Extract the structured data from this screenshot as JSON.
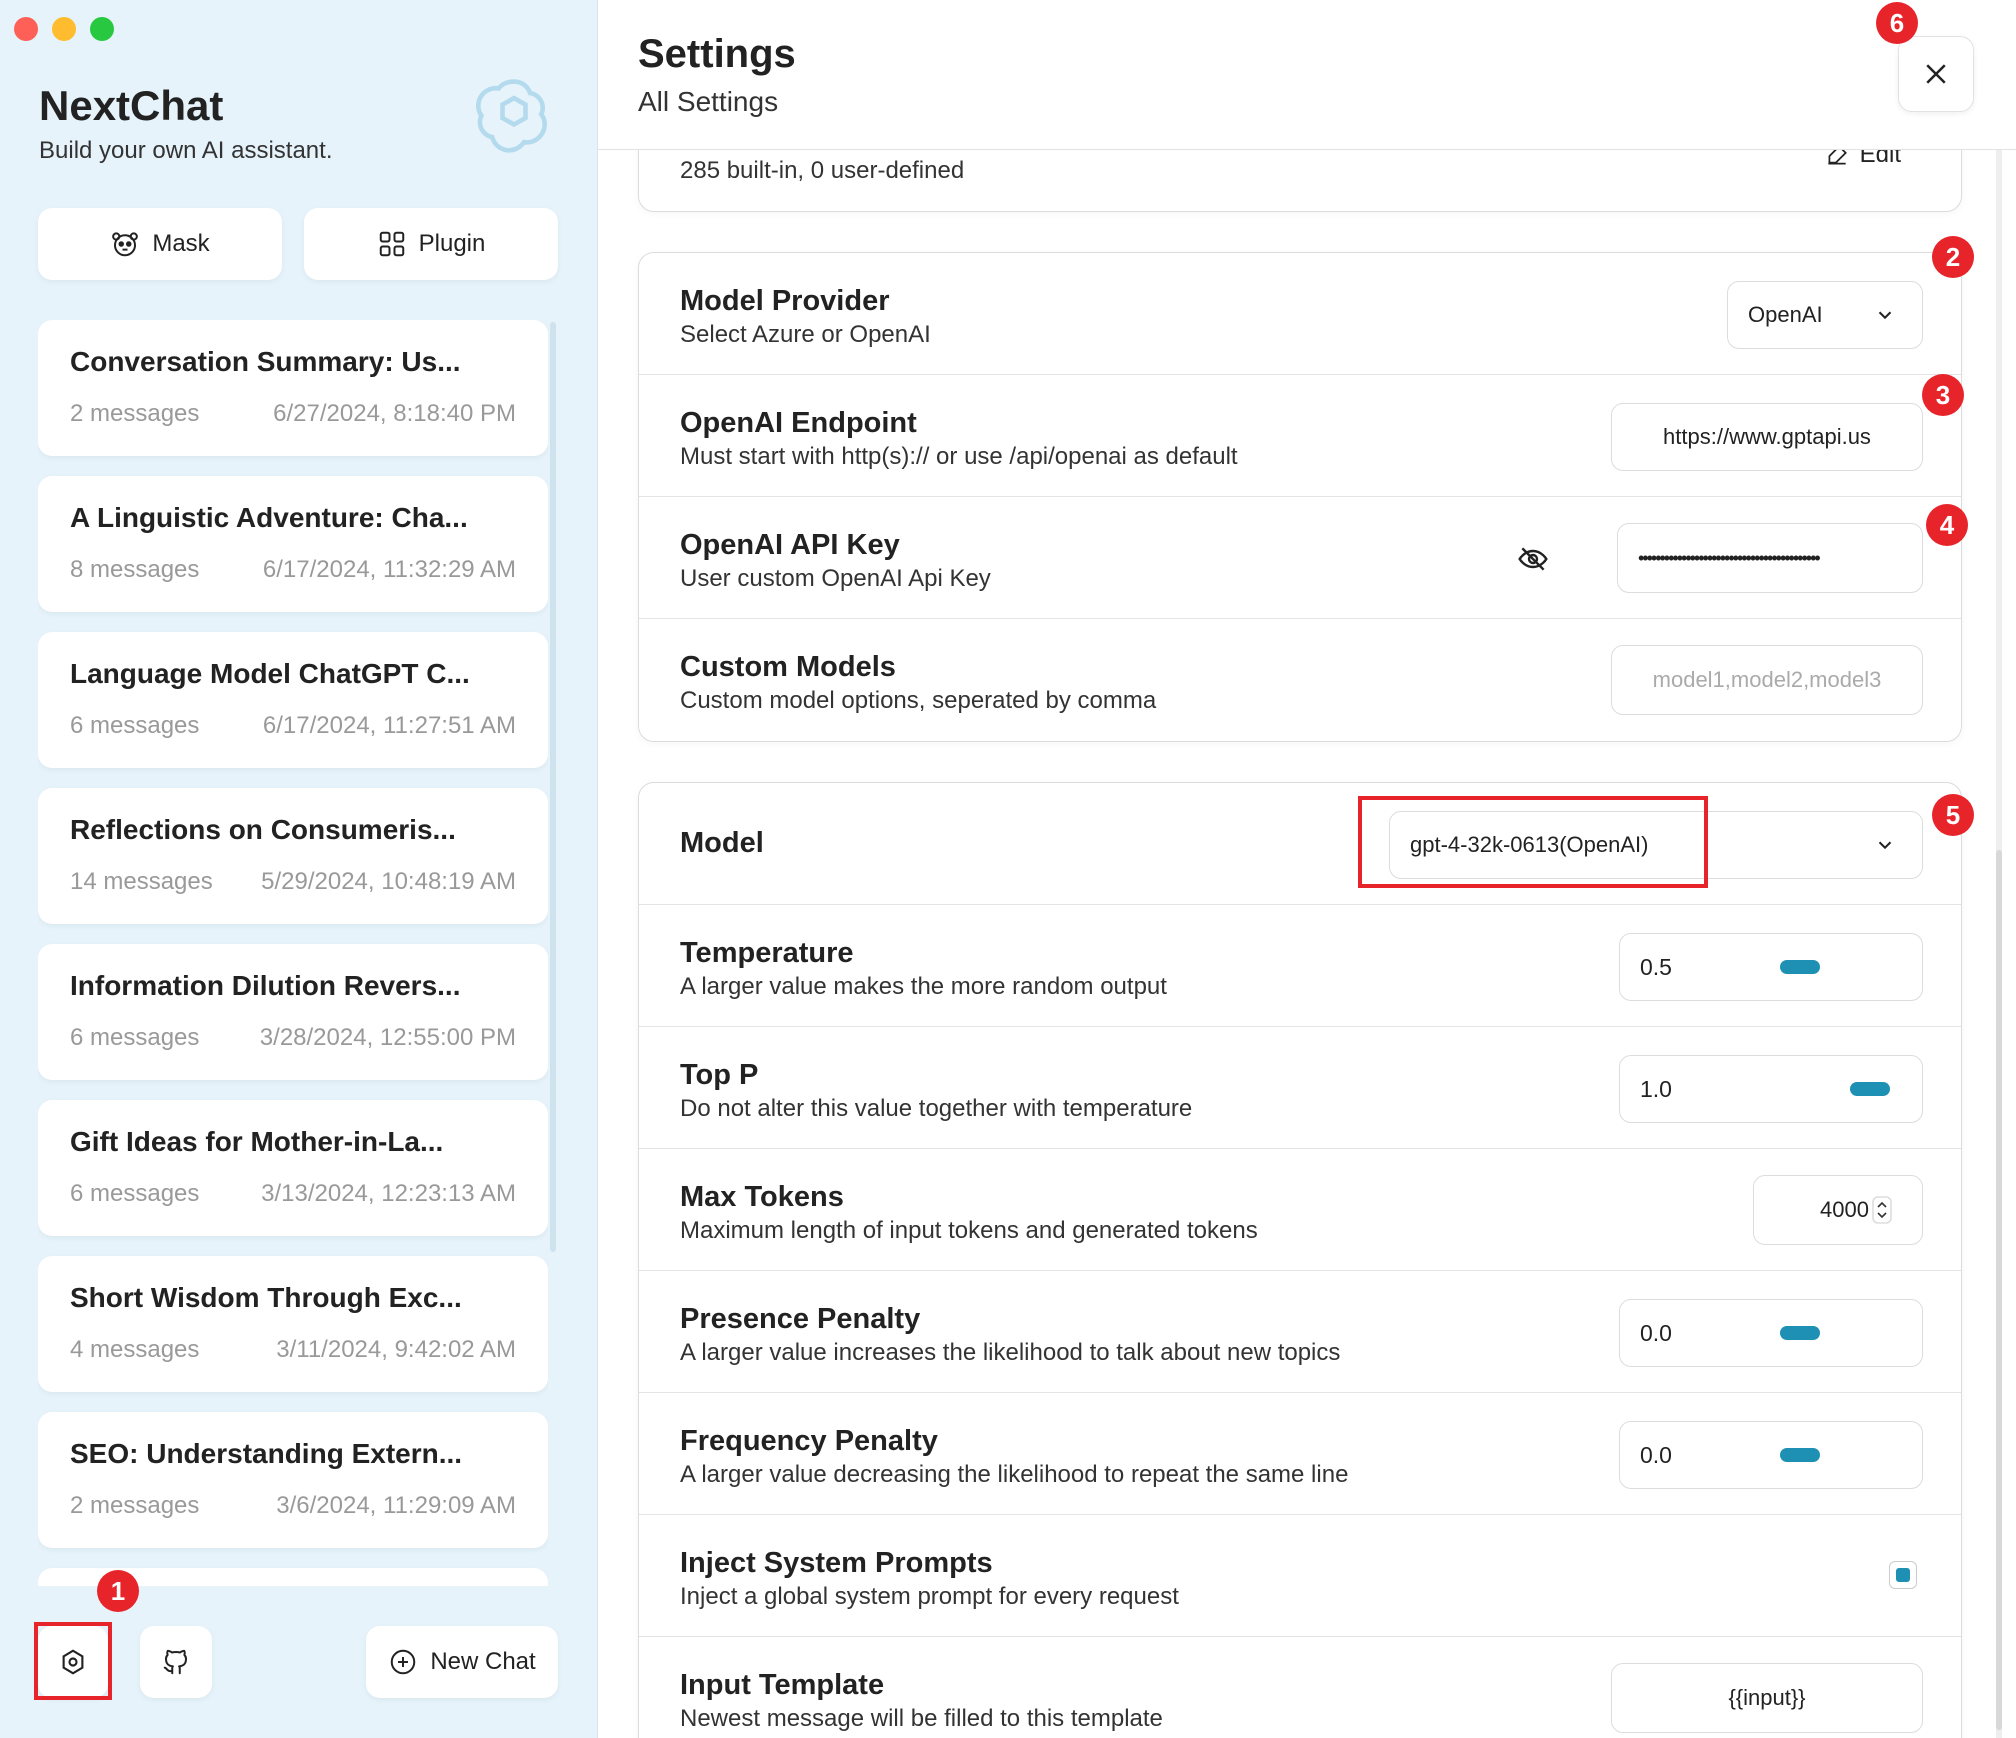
{
  "sidebar": {
    "app_title": "NextChat",
    "app_subtitle": "Build your own AI assistant.",
    "mask_label": "Mask",
    "plugin_label": "Plugin",
    "chats": [
      {
        "title": "Conversation Summary: Us...",
        "count": "2 messages",
        "date": "6/27/2024, 8:18:40 PM"
      },
      {
        "title": "A Linguistic Adventure: Cha...",
        "count": "8 messages",
        "date": "6/17/2024, 11:32:29 AM"
      },
      {
        "title": "Language Model ChatGPT C...",
        "count": "6 messages",
        "date": "6/17/2024, 11:27:51 AM"
      },
      {
        "title": "Reflections on Consumeris...",
        "count": "14 messages",
        "date": "5/29/2024, 10:48:19 AM"
      },
      {
        "title": "Information Dilution Revers...",
        "count": "6 messages",
        "date": "3/28/2024, 12:55:00 PM"
      },
      {
        "title": "Gift Ideas for Mother-in-La...",
        "count": "6 messages",
        "date": "3/13/2024, 12:23:13 AM"
      },
      {
        "title": "Short Wisdom Through Exc...",
        "count": "4 messages",
        "date": "3/11/2024, 9:42:02 AM"
      },
      {
        "title": "SEO: Understanding Extern...",
        "count": "2 messages",
        "date": "3/6/2024, 11:29:09 AM"
      }
    ],
    "new_chat_label": "New Chat"
  },
  "annotations": [
    "1",
    "2",
    "3",
    "4",
    "5",
    "6"
  ],
  "settings": {
    "title": "Settings",
    "subtitle": "All Settings",
    "mask_row": {
      "desc": "285 built-in, 0 user-defined",
      "edit_label": "Edit"
    },
    "provider": {
      "title": "Model Provider",
      "desc": "Select Azure or OpenAI",
      "value": "OpenAI"
    },
    "endpoint": {
      "title": "OpenAI Endpoint",
      "desc": "Must start with http(s):// or use /api/openai as default",
      "value": "https://www.gptapi.us"
    },
    "api_key": {
      "title": "OpenAI API Key",
      "desc": "User custom OpenAI Api Key",
      "value": "••••••••••••••••••••••••••••••••••••••••••"
    },
    "custom_models": {
      "title": "Custom Models",
      "desc": "Custom model options, seperated by comma",
      "placeholder": "model1,model2,model3"
    },
    "model": {
      "title": "Model",
      "value": "gpt-4-32k-0613(OpenAI)"
    },
    "temperature": {
      "title": "Temperature",
      "desc": "A larger value makes the more random output",
      "value": "0.5",
      "level": 0.5
    },
    "top_p": {
      "title": "Top P",
      "desc": "Do not alter this value together with temperature",
      "value": "1.0",
      "level": 1.0
    },
    "max_tokens": {
      "title": "Max Tokens",
      "desc": "Maximum length of input tokens and generated tokens",
      "value": "4000"
    },
    "presence_penalty": {
      "title": "Presence Penalty",
      "desc": "A larger value increases the likelihood to talk about new topics",
      "value": "0.0",
      "level": 0.5
    },
    "frequency_penalty": {
      "title": "Frequency Penalty",
      "desc": "A larger value decreasing the likelihood to repeat the same line",
      "value": "0.0",
      "level": 0.5
    },
    "inject_prompts": {
      "title": "Inject System Prompts",
      "desc": "Inject a global system prompt for every request",
      "checked": true
    },
    "input_template": {
      "title": "Input Template",
      "desc": "Newest message will be filled to this template",
      "value": "{{input}}"
    }
  },
  "colors": {
    "accent": "#1e90b4",
    "annotation_red": "#e8242b",
    "sidebar_bg": "#e6f3fb"
  }
}
